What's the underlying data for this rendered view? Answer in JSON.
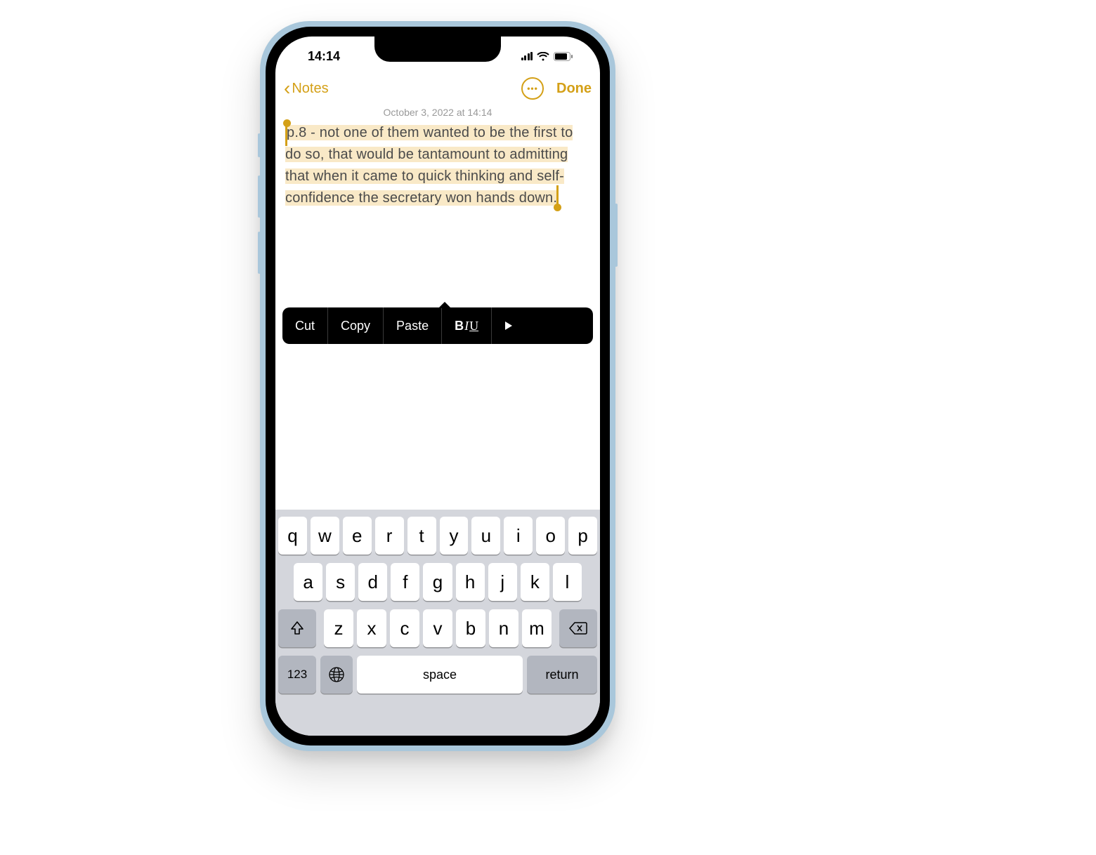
{
  "status": {
    "time": "14:14"
  },
  "nav": {
    "back_label": "Notes",
    "done_label": "Done"
  },
  "note": {
    "timestamp": "October 3, 2022 at 14:14",
    "body": "p.8 - not one of them wanted to be the first to do so, that would be tantamount to admitting that when it came to quick thinking and self-confidence the secretary won hands down."
  },
  "context_menu": {
    "items": [
      "Cut",
      "Copy",
      "Paste"
    ],
    "format_label": {
      "b": "B",
      "i": "I",
      "u": "U"
    }
  },
  "keyboard": {
    "row1": [
      "q",
      "w",
      "e",
      "r",
      "t",
      "y",
      "u",
      "i",
      "o",
      "p"
    ],
    "row2": [
      "a",
      "s",
      "d",
      "f",
      "g",
      "h",
      "j",
      "k",
      "l"
    ],
    "row3": [
      "z",
      "x",
      "c",
      "v",
      "b",
      "n",
      "m"
    ],
    "numbers_label": "123",
    "space_label": "space",
    "return_label": "return"
  }
}
